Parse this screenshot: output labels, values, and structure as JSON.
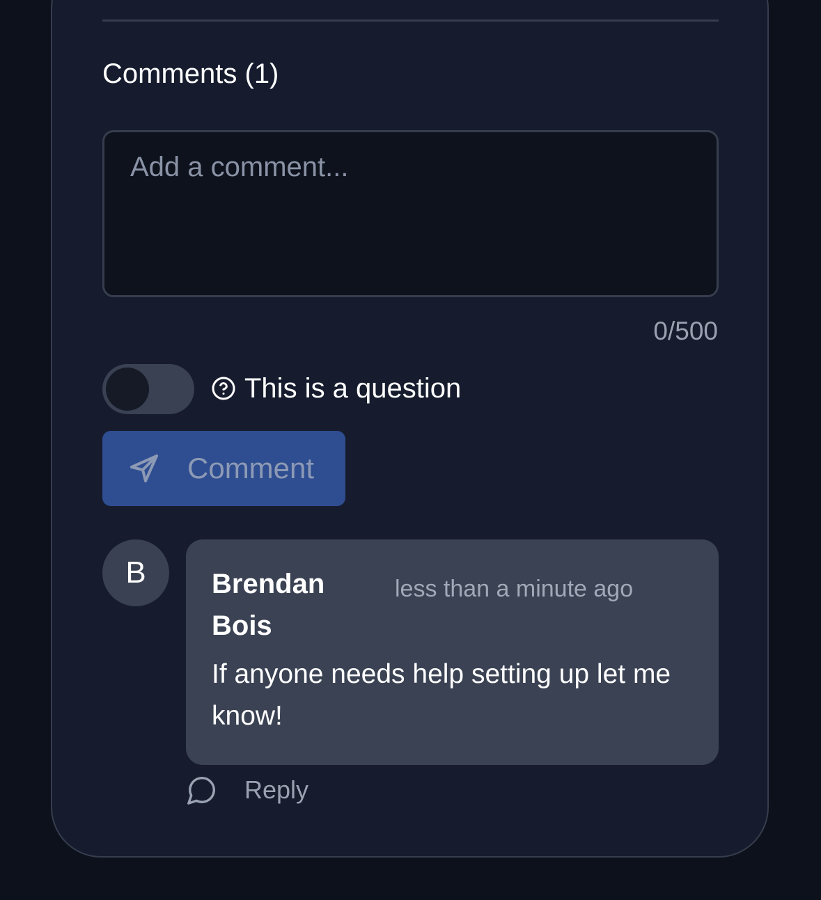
{
  "comments": {
    "title": "Comments (1)",
    "input": {
      "placeholder": "Add a comment...",
      "value": "",
      "char_count": "0/500"
    },
    "question_toggle": {
      "label": "This is a question",
      "on": false,
      "icon": "question-circle-icon"
    },
    "submit": {
      "label": "Comment",
      "icon": "send-icon"
    },
    "items": [
      {
        "avatar_initial": "B",
        "author": "Brendan Bois",
        "time": "less than a minute ago",
        "text": "If anyone needs help setting up let me know!",
        "reply_label": "Reply",
        "reply_icon": "chat-bubble-icon"
      }
    ]
  },
  "colors": {
    "page_background": "#0d111c",
    "card_background": "#161c2e",
    "accent_button": "#2f4e91",
    "bubble_background": "#3a4253"
  }
}
